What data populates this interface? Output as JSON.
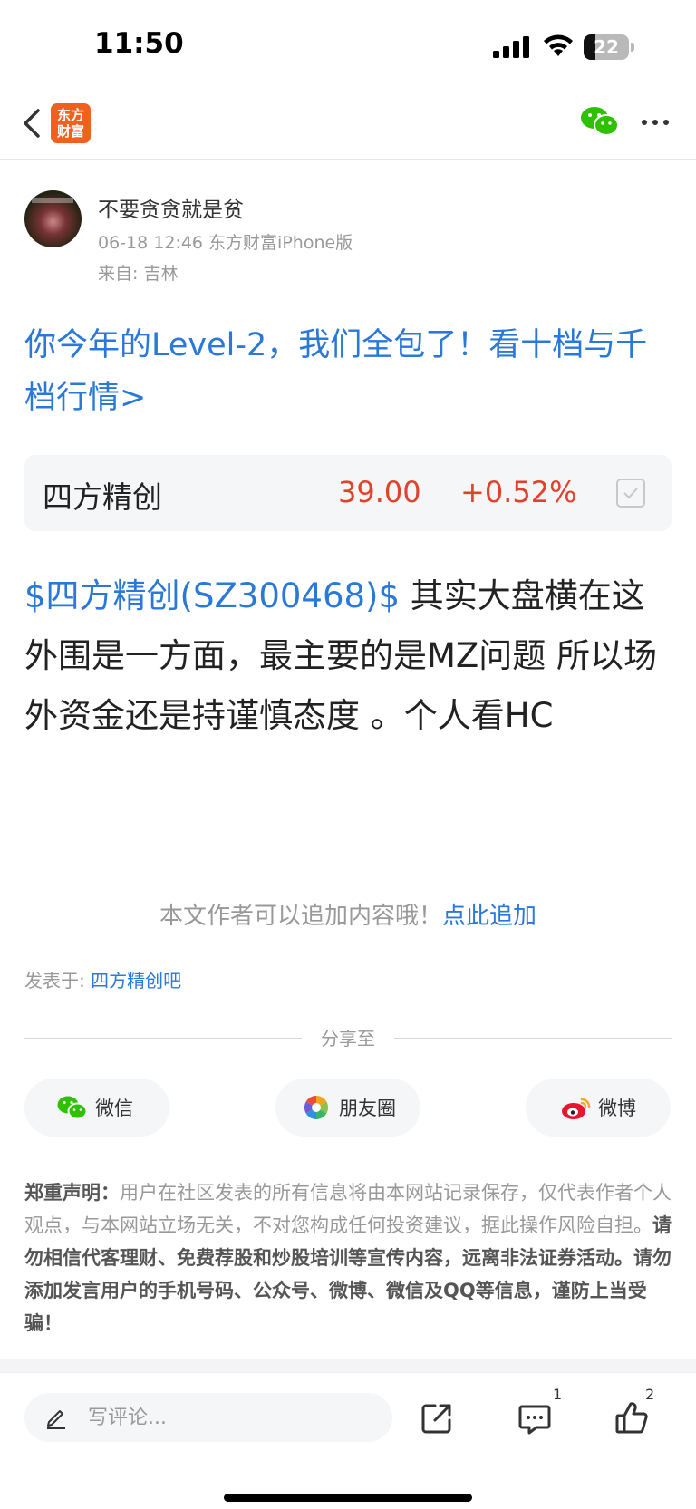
{
  "status_bar": {
    "time": "11:50",
    "battery": "22"
  },
  "nav": {
    "logo_text_line1": "东方",
    "logo_text_line2": "财富"
  },
  "author": {
    "name": "不要贪贪就是贫",
    "meta": "06-18 12:46 东方财富iPhone版",
    "location": "来自: 吉林"
  },
  "ad_link": "你今年的Level-2，我们全包了！看十档与千档行情>",
  "stock_card": {
    "name": "四方精创",
    "price": "39.00",
    "change": "+0.52%"
  },
  "post": {
    "stock_tag": "$四方精创(SZ300468)$",
    "text": "  其实大盘横在这 外围是一方面，最主要的是MZ问题 所以场外资金还是持谨慎态度 。个人看HC"
  },
  "append": {
    "hint": "本文作者可以追加内容哦！",
    "link": "点此追加"
  },
  "posted_in": {
    "label": "发表于: ",
    "bar": "四方精创吧"
  },
  "share": {
    "label": "分享至",
    "wechat": "微信",
    "moments": "朋友圈",
    "weibo": "微博"
  },
  "disclaimer": {
    "title": "郑重声明：",
    "body": "用户在社区发表的所有信息将由本网站记录保存，仅代表作者个人观点，与本网站立场无关，不对您构成任何投资建议，据此操作风险自担。",
    "warning": "请勿相信代客理财、免费荐股和炒股培训等宣传内容，远离非法证券活动。请勿添加发言用户的手机号码、公众号、微博、微信及QQ等信息，谨防上当受骗！"
  },
  "bottom_bar": {
    "comment_placeholder": "写评论...",
    "comment_count": "1",
    "like_count": "2"
  },
  "colors": {
    "link_blue": "#2a78d8",
    "stock_red": "#e0432b",
    "brand_orange": "#f2601e"
  }
}
